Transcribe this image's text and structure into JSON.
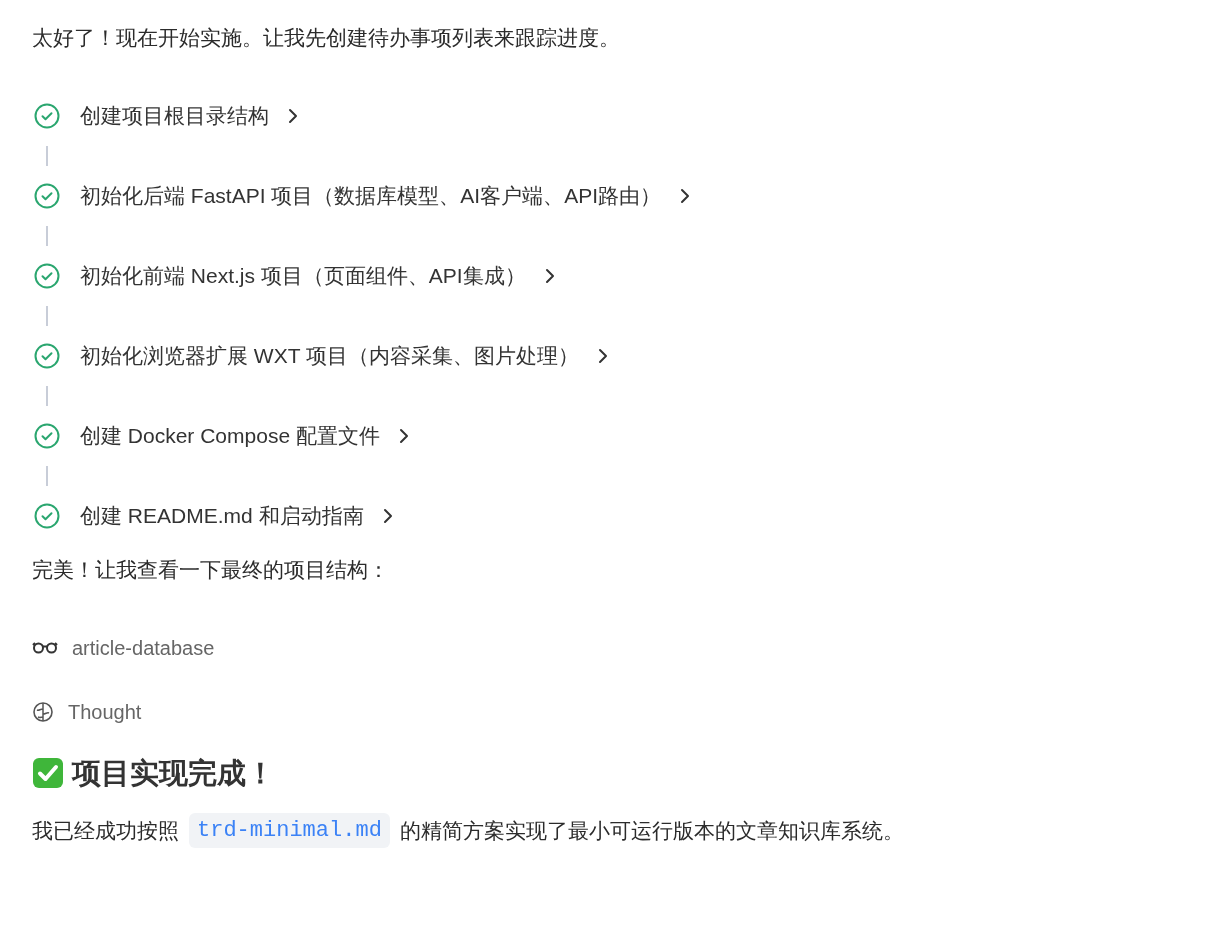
{
  "intro": "太好了！现在开始实施。让我先创建待办事项列表来跟踪进度。",
  "todos": [
    {
      "label": "创建项目根目录结构",
      "completed": true
    },
    {
      "label": "初始化后端 FastAPI 项目（数据库模型、AI客户端、API路由）",
      "completed": true
    },
    {
      "label": "初始化前端 Next.js 项目（页面组件、API集成）",
      "completed": true
    },
    {
      "label": "初始化浏览器扩展 WXT 项目（内容采集、图片处理）",
      "completed": true
    },
    {
      "label": "创建 Docker Compose 配置文件",
      "completed": true
    },
    {
      "label": "创建 README.md 和启动指南",
      "completed": true
    }
  ],
  "after_todos": "完美！让我查看一下最终的项目结构：",
  "tool_steps": [
    {
      "kind": "explore",
      "label": "article-database"
    },
    {
      "kind": "thought",
      "label": "Thought"
    }
  ],
  "heading": "项目实现完成！",
  "summary": {
    "before": "我已经成功按照",
    "code": "trd-minimal.md",
    "after": "的精简方案实现了最小可运行版本的文章知识库系统。"
  }
}
